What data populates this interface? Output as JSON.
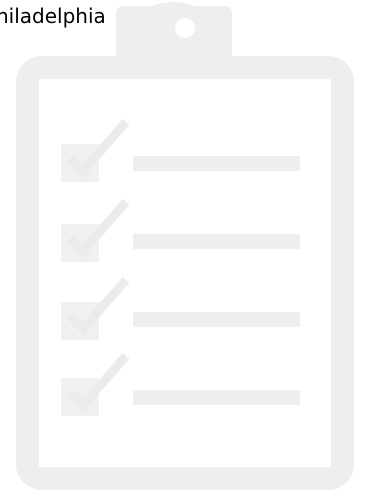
{
  "caption": "hiladelphia",
  "illustration": {
    "icon": "clipboard-checklist-icon",
    "item_count": 4,
    "colors": {
      "board": "#eeeeee",
      "paper": "#ffffff",
      "clip": "#eeeeee",
      "checkbox": "#f0f0f0",
      "line": "#eeeeee"
    }
  }
}
